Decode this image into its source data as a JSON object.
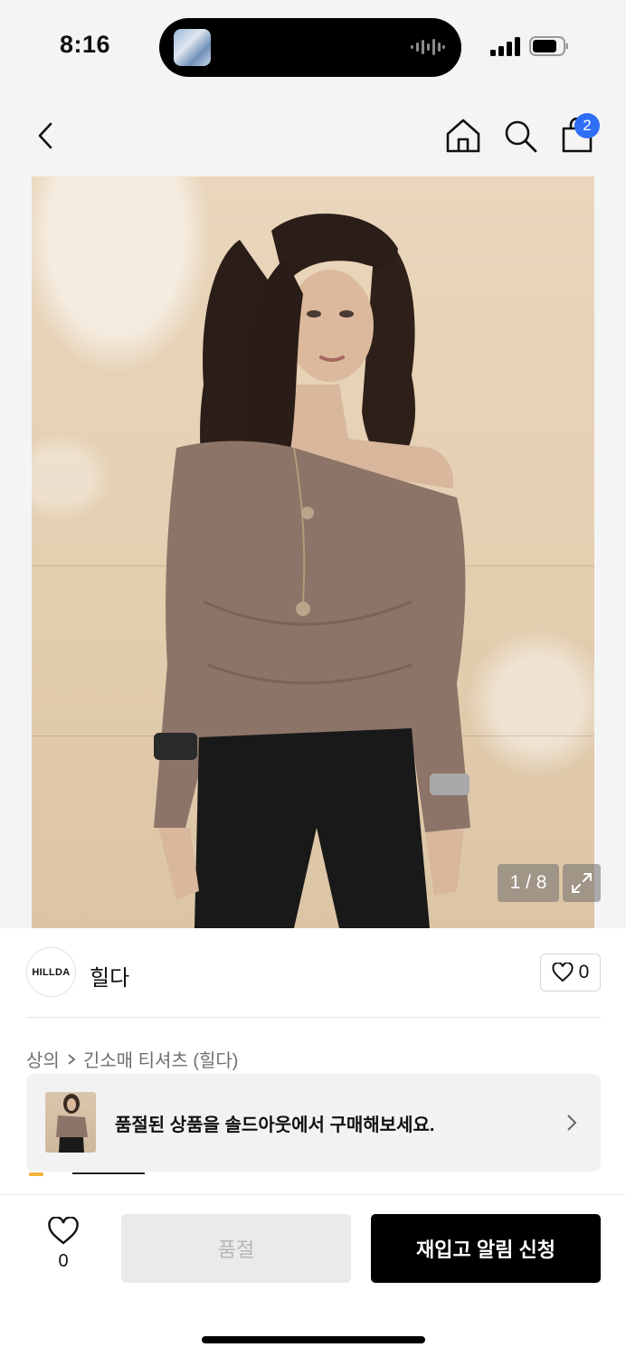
{
  "status_bar": {
    "time": "8:16",
    "colors": {
      "island": "#000000"
    },
    "icons": [
      "now-playing-thumb",
      "audio-wave-icon",
      "signal-icon",
      "battery-icon"
    ]
  },
  "nav": {
    "icons": [
      "back-icon",
      "home-icon",
      "search-icon",
      "shopping-bag-icon"
    ],
    "cart_count": "2",
    "badge_color": "#2f6ef6"
  },
  "gallery": {
    "counter": "1 / 8",
    "icons": [
      "expand-icon"
    ]
  },
  "brand": {
    "logo_text": "HILLDA",
    "name": "힐다",
    "like_count": "0"
  },
  "breadcrumb": {
    "category": "상의",
    "product": "긴소매 티셔츠 (힐다)"
  },
  "soldout_banner": {
    "text": "품절된 상품을 솔드아웃에서 구매해보세요."
  },
  "bottom_bar": {
    "wish_count": "0",
    "soldout_label": "품절",
    "restock_label": "재입고 알림 신청",
    "colors": {
      "primary": "#000000",
      "disabled": "#eaeaea"
    }
  }
}
